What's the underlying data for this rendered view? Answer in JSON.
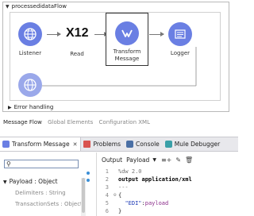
{
  "flow": {
    "name": "processedidataFlow",
    "processors": [
      {
        "label": "Listener"
      },
      {
        "label": "Read",
        "badge": "X12"
      },
      {
        "label": "Transform",
        "label2": "Message"
      },
      {
        "label": "Logger"
      }
    ],
    "error_handling": "Error handling"
  },
  "view_tabs": [
    "Message Flow",
    "Global Elements",
    "Configuration XML"
  ],
  "pane_tabs": [
    {
      "label": "Transform Message",
      "icon": "transform-icon",
      "active": true
    },
    {
      "label": "Problems",
      "icon": "problems-icon"
    },
    {
      "label": "Console",
      "icon": "console-icon"
    },
    {
      "label": "Mule Debugger",
      "icon": "debugger-icon"
    }
  ],
  "input_tree": {
    "search_value": "",
    "root": "Payload : Object",
    "children": [
      "Delimiters : String",
      "TransactionSets : Object"
    ]
  },
  "output": {
    "label": "Output",
    "target": "Payload",
    "code": [
      {
        "n": "1",
        "text": "%dw 2.0"
      },
      {
        "n": "2",
        "text": "output application/xml"
      },
      {
        "n": "3",
        "text": "---"
      },
      {
        "n": "4",
        "text": "{"
      },
      {
        "n": "5",
        "key": "\"EDI\"",
        "sep": ":",
        "value": "payload"
      },
      {
        "n": "6",
        "text": "}"
      }
    ]
  },
  "colors": {
    "processor": "#6a7fe3",
    "processor_light": "#9aa8ea",
    "mapping_dot": "#3b8fd6"
  }
}
